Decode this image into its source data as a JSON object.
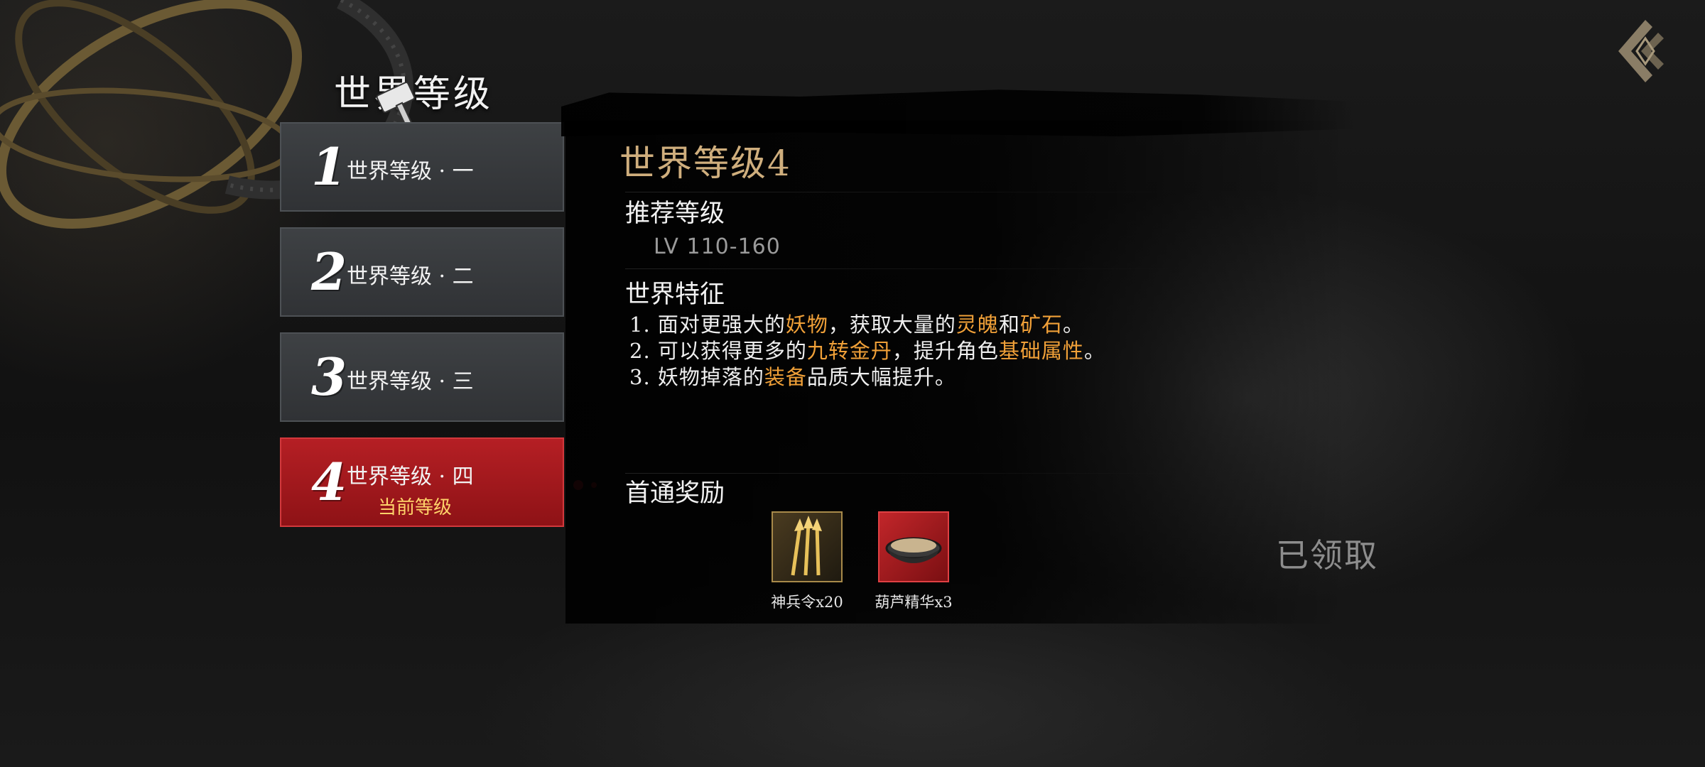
{
  "page": {
    "title": "世界等级"
  },
  "levels": [
    {
      "num": "1",
      "name": "世界等级 · 一",
      "current": ""
    },
    {
      "num": "2",
      "name": "世界等级 · 二",
      "current": ""
    },
    {
      "num": "3",
      "name": "世界等级 · 三",
      "current": ""
    },
    {
      "num": "4",
      "name": "世界等级 · 四",
      "current": "当前等级"
    }
  ],
  "selected_level": 4,
  "detail": {
    "title": "世界等级4",
    "recommend_label": "推荐等级",
    "level_range": "LV 110-160",
    "features_label": "世界特征",
    "features": [
      {
        "pre": "1. 面对更强大的",
        "hl1": "妖物",
        "mid1": "，获取大量的",
        "hl2": "灵魄",
        "mid2": "和",
        "hl3": "矿石",
        "post": "。"
      },
      {
        "pre": "2. 可以获得更多的",
        "hl1": "九转金丹",
        "mid1": "，提升角色",
        "hl2": "基础属性",
        "mid2": "",
        "hl3": "",
        "post": "。"
      },
      {
        "pre": "3. 妖物掉落的",
        "hl1": "装备",
        "mid1": "品质大幅提升。",
        "hl2": "",
        "mid2": "",
        "hl3": "",
        "post": ""
      }
    ],
    "highlight_color": "#f0a038",
    "rewards_label": "首通奖励",
    "rewards": [
      {
        "icon": "divine-arrows-icon",
        "label": "神兵令x20"
      },
      {
        "icon": "gourd-essence-bowl-icon",
        "label": "葫芦精华x3"
      }
    ],
    "claim_status": "已领取"
  },
  "colors": {
    "accent_red": "#b51f24",
    "title_gold": "#cfae7d",
    "current_label": "#ffd36a"
  }
}
